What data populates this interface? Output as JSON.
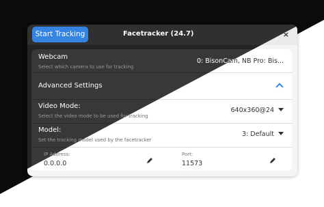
{
  "header": {
    "start_label": "Start Tracking",
    "title": "Facetracker (24.7)",
    "close_glyph": "×"
  },
  "webcam": {
    "label": "Webcam",
    "subtitle": "Select which camera to use for tracking",
    "value": "0: BisonCam, NB Pro: Bis..."
  },
  "advanced": {
    "label": "Advanced Settings"
  },
  "video_mode": {
    "label": "Video Mode:",
    "subtitle": "Select the video mode to be used for tracking",
    "value": "640x360@24"
  },
  "model": {
    "label": "Model:",
    "subtitle": "Set the tracking model used by the facetracker",
    "value": "3: Default"
  },
  "ip": {
    "label": "IP Address:",
    "value": "0.0.0.0"
  },
  "port": {
    "label": "Port:",
    "value": "11573"
  },
  "icons": [
    "close-icon",
    "chevron-up-icon",
    "caret-down-icon",
    "pencil-icon"
  ],
  "colors": {
    "accent": "#3584e4",
    "dark_bg": "#242424",
    "light_bg": "#f6f5f4"
  }
}
